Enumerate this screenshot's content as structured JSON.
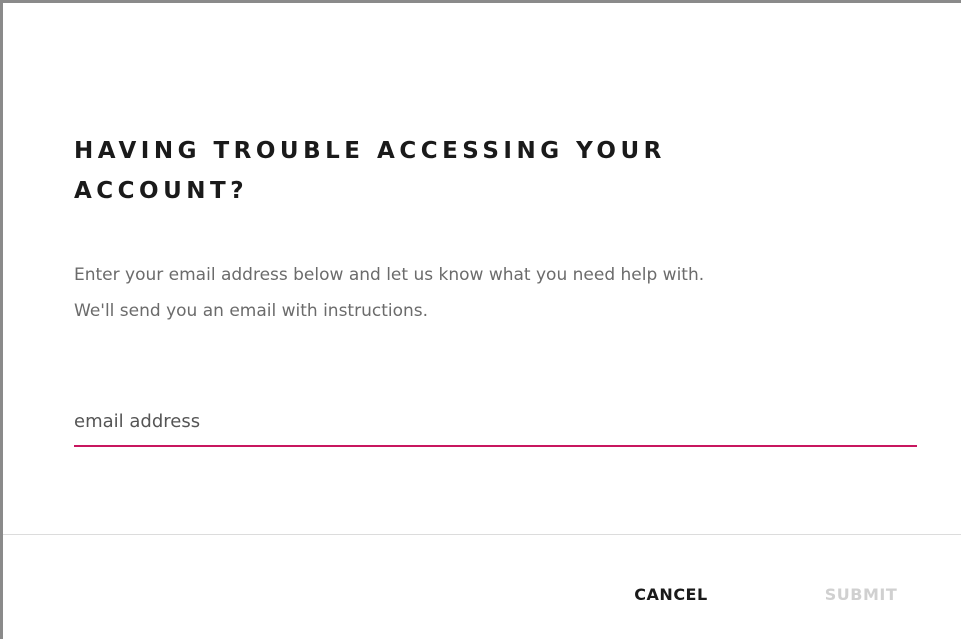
{
  "dialog": {
    "title_line1": "HAVING TROUBLE ACCESSING YOUR",
    "title_line2": "ACCOUNT?",
    "description_line1": "Enter your email address below and let us know what you need help with.",
    "description_line2": "We'll send you an email with instructions.",
    "email_placeholder": "email address",
    "email_value": "",
    "cancel_label": "CANCEL",
    "submit_label": "SUBMIT"
  },
  "colors": {
    "accent": "#c8165f",
    "title_text": "#1a1a1a",
    "body_text": "#6b6b6b",
    "disabled_text": "#d0d0d0",
    "divider": "#dcdcdc",
    "frame_border": "#8a8a8a"
  }
}
